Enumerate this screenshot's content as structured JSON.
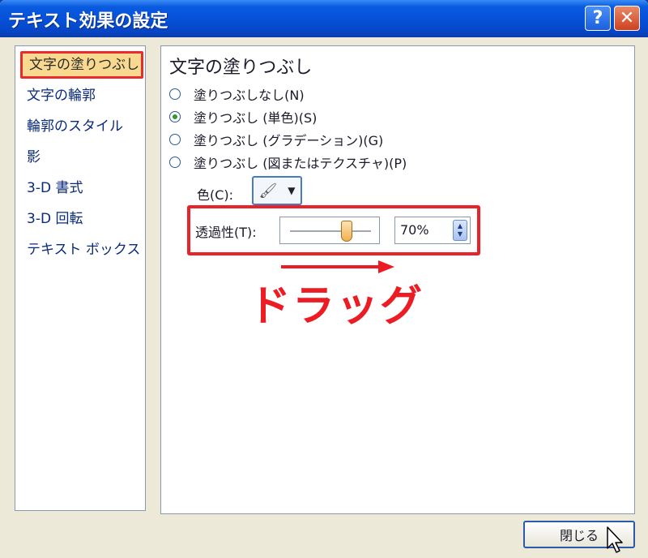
{
  "window": {
    "title": "テキスト効果の設定",
    "help_label": "?",
    "close_label": "✕"
  },
  "sidebar": {
    "items": [
      {
        "label": "文字の塗りつぶし",
        "selected": true
      },
      {
        "label": "文字の輪郭"
      },
      {
        "label": "輪郭のスタイル"
      },
      {
        "label": "影"
      },
      {
        "label": "3-D 書式"
      },
      {
        "label": "3-D 回転"
      },
      {
        "label": "テキスト ボックス"
      }
    ]
  },
  "panel": {
    "title": "文字の塗りつぶし",
    "options": [
      {
        "label": "塗りつぶしなし(N)",
        "checked": false
      },
      {
        "label": "塗りつぶし (単色)(S)",
        "checked": true
      },
      {
        "label": "塗りつぶし (グラデーション)(G)",
        "checked": false
      },
      {
        "label": "塗りつぶし (図またはテクスチャ)(P)",
        "checked": false
      }
    ],
    "color_label": "色(C):",
    "transparency_label": "透過性(T):",
    "transparency_value": "70%",
    "transparency_fraction": 0.7
  },
  "annotation": {
    "drag_text": "ドラッグ",
    "accent_color": "#ec1c24"
  },
  "footer": {
    "close_button": "閉じる"
  }
}
